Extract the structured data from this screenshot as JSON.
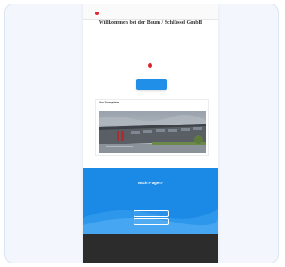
{
  "nav": {
    "brand": "",
    "links": [
      "",
      "",
      "",
      "",
      "",
      ""
    ]
  },
  "hero": {
    "headline": "Willkommen bei der Baum / Schlüssel GmbH",
    "p1": "",
    "p2": "",
    "signature": "",
    "p3": "",
    "cta_line1": "",
    "cta_line2": ""
  },
  "photo": {
    "label": "Unser Firmengebäude"
  },
  "blue": {
    "title": "Noch Fragen?",
    "text": "",
    "button1": "",
    "button2": ""
  },
  "footer": {
    "col1_title": "",
    "col1_links": [
      "",
      ""
    ],
    "col2_title": "",
    "col2_links": [
      "",
      ""
    ],
    "col3_title": "",
    "col3_links": [
      "",
      ""
    ]
  },
  "colors": {
    "accent": "#1f8fe8",
    "section_blue": "#1b8ae6",
    "footer": "#2c2c2c",
    "logo_red": "#e0262f"
  }
}
